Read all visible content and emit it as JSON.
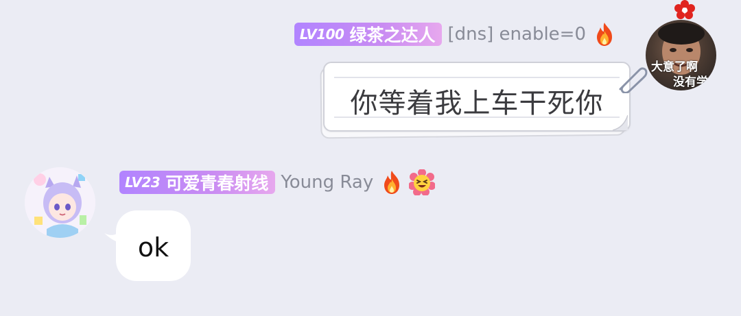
{
  "messages": [
    {
      "side": "right",
      "level": "LV100",
      "badge_title": "绿茶之达人",
      "sender": "[dns] enable=0",
      "text": "你等着我上车干死你",
      "avatar_caption_1": "大意了啊",
      "avatar_caption_2": "没有学"
    },
    {
      "side": "left",
      "level": "LV23",
      "badge_title": "可爱青春射线",
      "sender": "Young Ray",
      "text": "ok"
    }
  ],
  "colors": {
    "background": "#ebecf4",
    "badge_gradient_start": "#b184ff",
    "badge_gradient_end": "#e7a8ee",
    "sender_name": "#888b97",
    "bubble": "#ffffff"
  },
  "icons": {
    "fire": "fire-icon",
    "laugh": "laughing-face-icon",
    "paperclip": "paperclip-icon",
    "flower": "flower-icon"
  }
}
